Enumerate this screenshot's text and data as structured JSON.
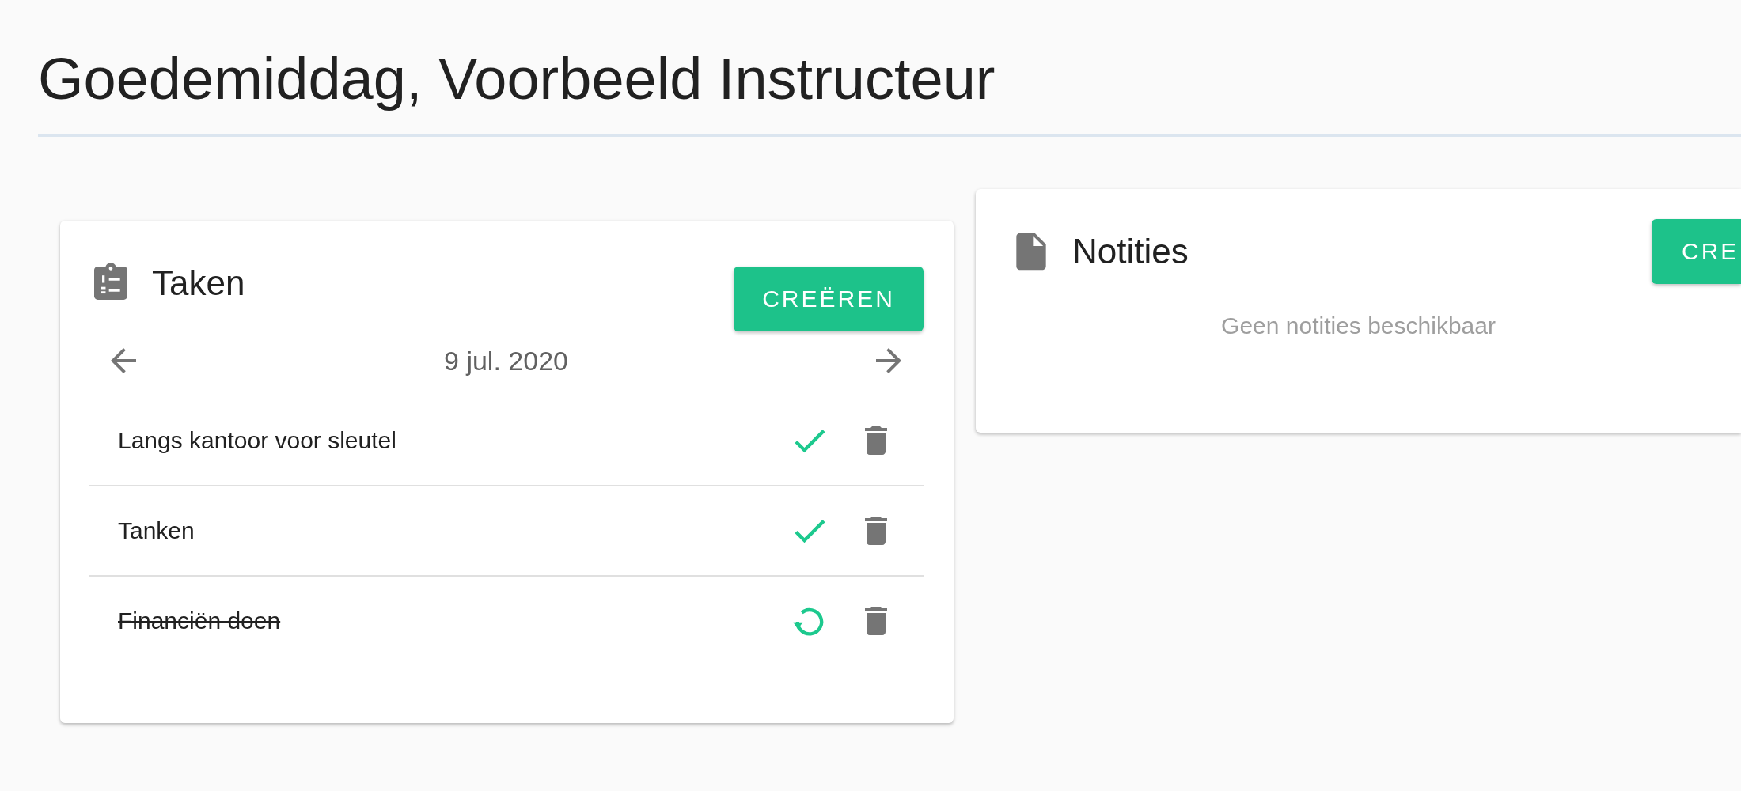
{
  "greeting": "Goedemiddag, Voorbeeld Instructeur",
  "cards": [
    {
      "kind": "tasks",
      "title": "Taken",
      "button": "CREËREN",
      "date": "9 jul. 2020",
      "tasks": [
        {
          "label": "Langs kantoor voor sleutel",
          "done": false
        },
        {
          "label": "Tanken",
          "done": false
        },
        {
          "label": "Financiën doen",
          "done": true
        }
      ]
    },
    {
      "kind": "notes",
      "title": "Notities",
      "button": "CRE",
      "empty_text": "Geen notities beschikbaar"
    }
  ]
}
